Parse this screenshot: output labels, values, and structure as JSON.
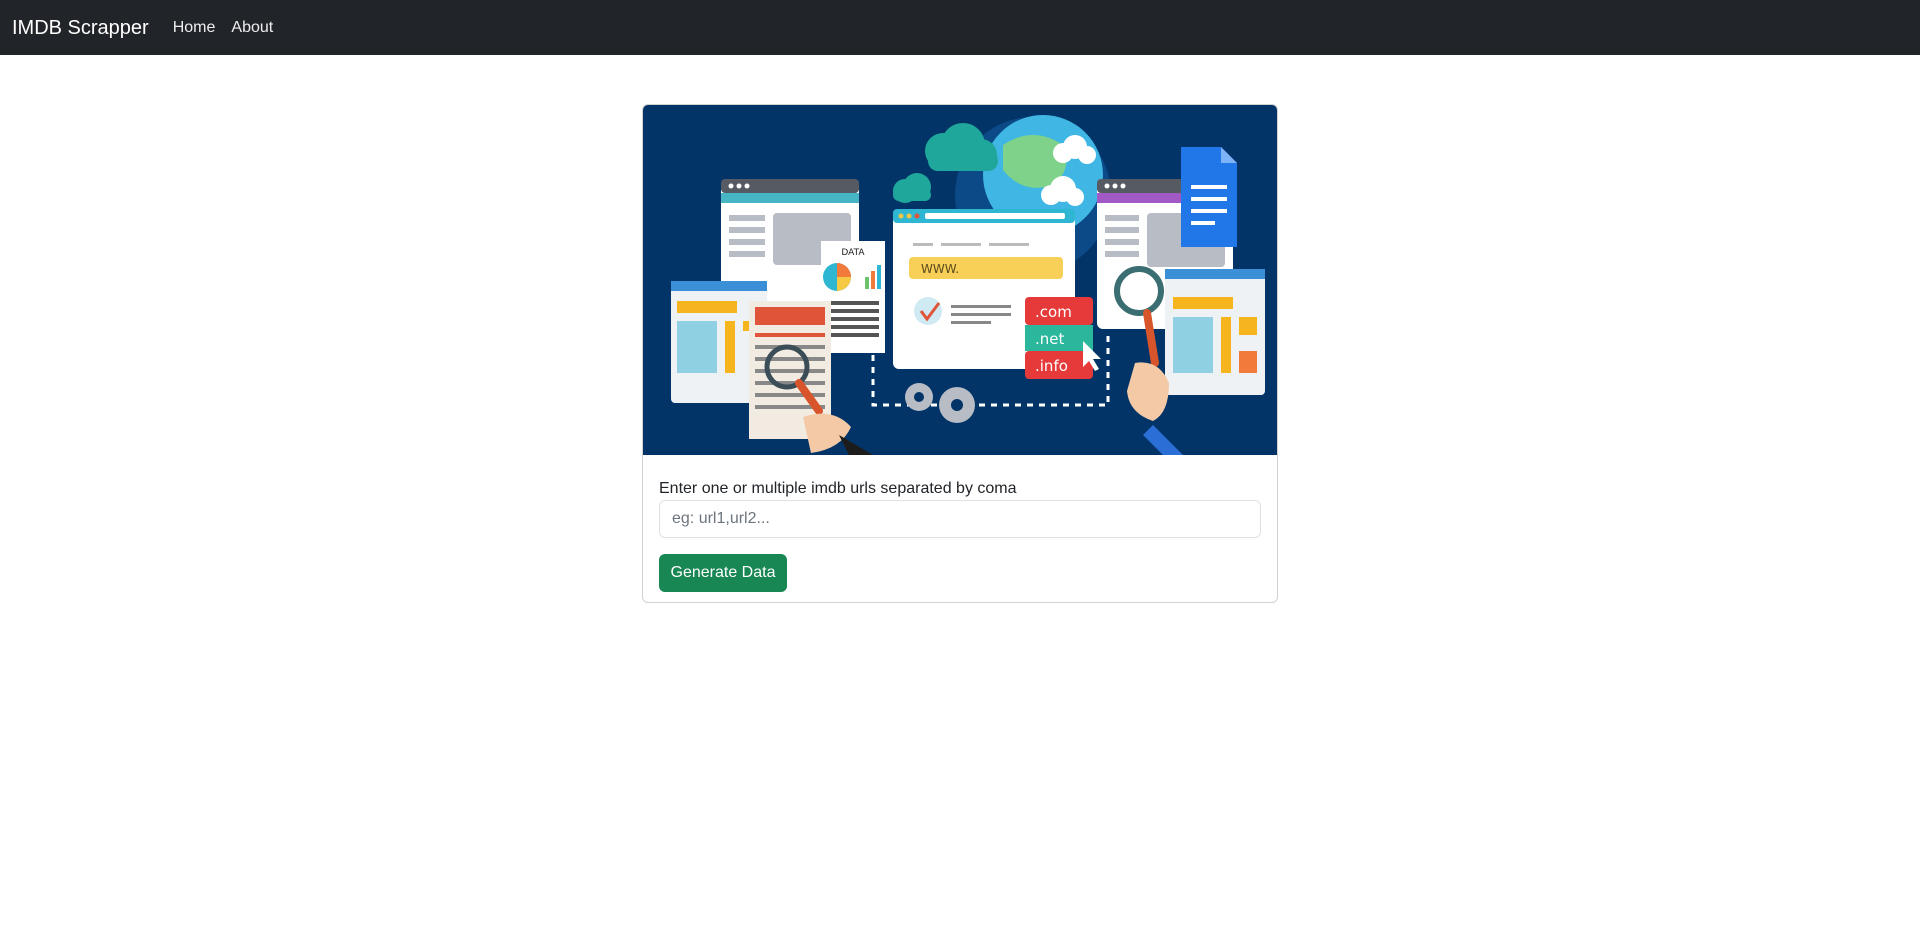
{
  "navbar": {
    "brand": "IMDB Scrapper",
    "links": [
      "Home",
      "About"
    ]
  },
  "hero": {
    "data_tag": "DATA",
    "url_bar_text": "WWW.",
    "domains": [
      ".com",
      ".net",
      ".info"
    ],
    "colors": {
      "background": "#033468",
      "com": "#e63a3a",
      "net": "#2bb79b",
      "info": "#e63a3a"
    }
  },
  "form": {
    "label": "Enter one or multiple imdb urls separated by coma",
    "placeholder": "eg: url1,url2...",
    "value": "",
    "submit_label": "Generate Data"
  },
  "colors": {
    "navbar_bg": "#212529",
    "button_bg": "#198754"
  }
}
